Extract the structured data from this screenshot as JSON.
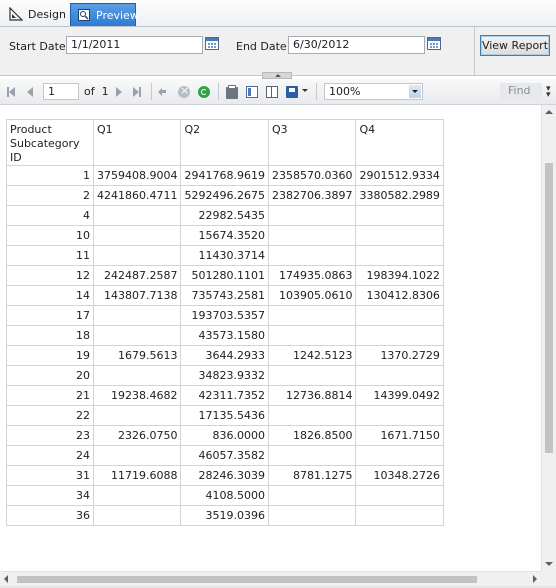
{
  "tabs": {
    "design": "Design",
    "preview": "Preview"
  },
  "parameters": {
    "start_date_label": "Start Date",
    "start_date_value": "1/1/2011",
    "end_date_label": "End Date",
    "end_date_value": "6/30/2012",
    "view_report_label": "View Report"
  },
  "toolbar": {
    "page_current": "1",
    "page_of": "of",
    "page_total": "1",
    "zoom": "100%",
    "find_label": "Find"
  },
  "report": {
    "headers": [
      "Product Subcategory ID",
      "Q1",
      "Q2",
      "Q3",
      "Q4"
    ],
    "rows": [
      [
        "1",
        "3759408.9004",
        "2941768.9619",
        "2358570.0360",
        "2901512.9334"
      ],
      [
        "2",
        "4241860.4711",
        "5292496.2675",
        "2382706.3897",
        "3380582.2989"
      ],
      [
        "4",
        "",
        "22982.5435",
        "",
        ""
      ],
      [
        "10",
        "",
        "15674.3520",
        "",
        ""
      ],
      [
        "11",
        "",
        "11430.3714",
        "",
        ""
      ],
      [
        "12",
        "242487.2587",
        "501280.1101",
        "174935.0863",
        "198394.1022"
      ],
      [
        "14",
        "143807.7138",
        "735743.2581",
        "103905.0610",
        "130412.8306"
      ],
      [
        "17",
        "",
        "193703.5357",
        "",
        ""
      ],
      [
        "18",
        "",
        "43573.1580",
        "",
        ""
      ],
      [
        "19",
        "1679.5613",
        "3644.2933",
        "1242.5123",
        "1370.2729"
      ],
      [
        "20",
        "",
        "34823.9332",
        "",
        ""
      ],
      [
        "21",
        "19238.4682",
        "42311.7352",
        "12736.8814",
        "14399.0492"
      ],
      [
        "22",
        "",
        "17135.5436",
        "",
        ""
      ],
      [
        "23",
        "2326.0750",
        "836.0000",
        "1826.8500",
        "1671.7150"
      ],
      [
        "24",
        "",
        "46057.3582",
        "",
        ""
      ],
      [
        "31",
        "11719.6088",
        "28246.3039",
        "8781.1275",
        "10348.2726"
      ],
      [
        "34",
        "",
        "4108.5000",
        "",
        ""
      ],
      [
        "36",
        "",
        "3519.0396",
        "",
        ""
      ]
    ]
  }
}
